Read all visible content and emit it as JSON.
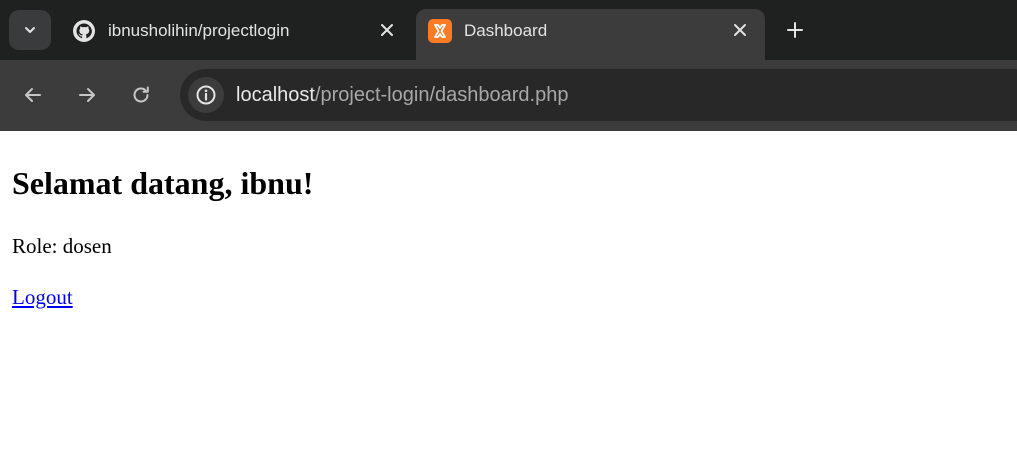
{
  "tabs": [
    {
      "title": "ibnusholihin/projectlogin",
      "favicon": "github-icon",
      "active": false
    },
    {
      "title": "Dashboard",
      "favicon": "xampp-icon",
      "active": true
    }
  ],
  "address_bar": {
    "host": "localhost",
    "path": "/project-login/dashboard.php"
  },
  "toolbar_icons": [
    "back-arrow-icon",
    "forward-arrow-icon",
    "reload-icon",
    "info-icon"
  ],
  "page": {
    "heading": "Selamat datang, ibnu!",
    "role_text": "Role: dosen",
    "logout_link": "Logout"
  },
  "colors": {
    "tabstrip_bg": "#1f2020",
    "active_tab_bg": "#3c3c3c",
    "omnibox_bg": "#282828",
    "xampp_orange": "#fb7a24",
    "link": "#0000ee"
  }
}
